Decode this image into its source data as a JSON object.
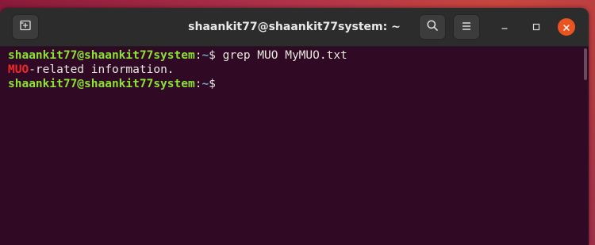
{
  "window": {
    "title": "shaankit77@shaankit77system: ~"
  },
  "titlebar": {
    "new_tab_icon": "new-tab-icon",
    "search_icon": "search-icon",
    "menu_icon": "hamburger-menu-icon",
    "minimize_icon": "minimize-icon",
    "maximize_icon": "maximize-icon",
    "close_icon": "close-icon"
  },
  "terminal": {
    "line1": {
      "user": "shaankit77@shaankit77system",
      "sep": ":",
      "path": "~",
      "dollar": "$ ",
      "command": "grep MUO MyMUO.txt"
    },
    "line2": {
      "match": "MUO",
      "rest": "-related information."
    },
    "line3": {
      "user": "shaankit77@shaankit77system",
      "sep": ":",
      "path": "~",
      "dollar": "$"
    }
  },
  "colors": {
    "terminal_bg": "#300a24",
    "prompt_user": "#8ae234",
    "prompt_path": "#729fcf",
    "match": "#ef2929",
    "close_button": "#e95420"
  }
}
